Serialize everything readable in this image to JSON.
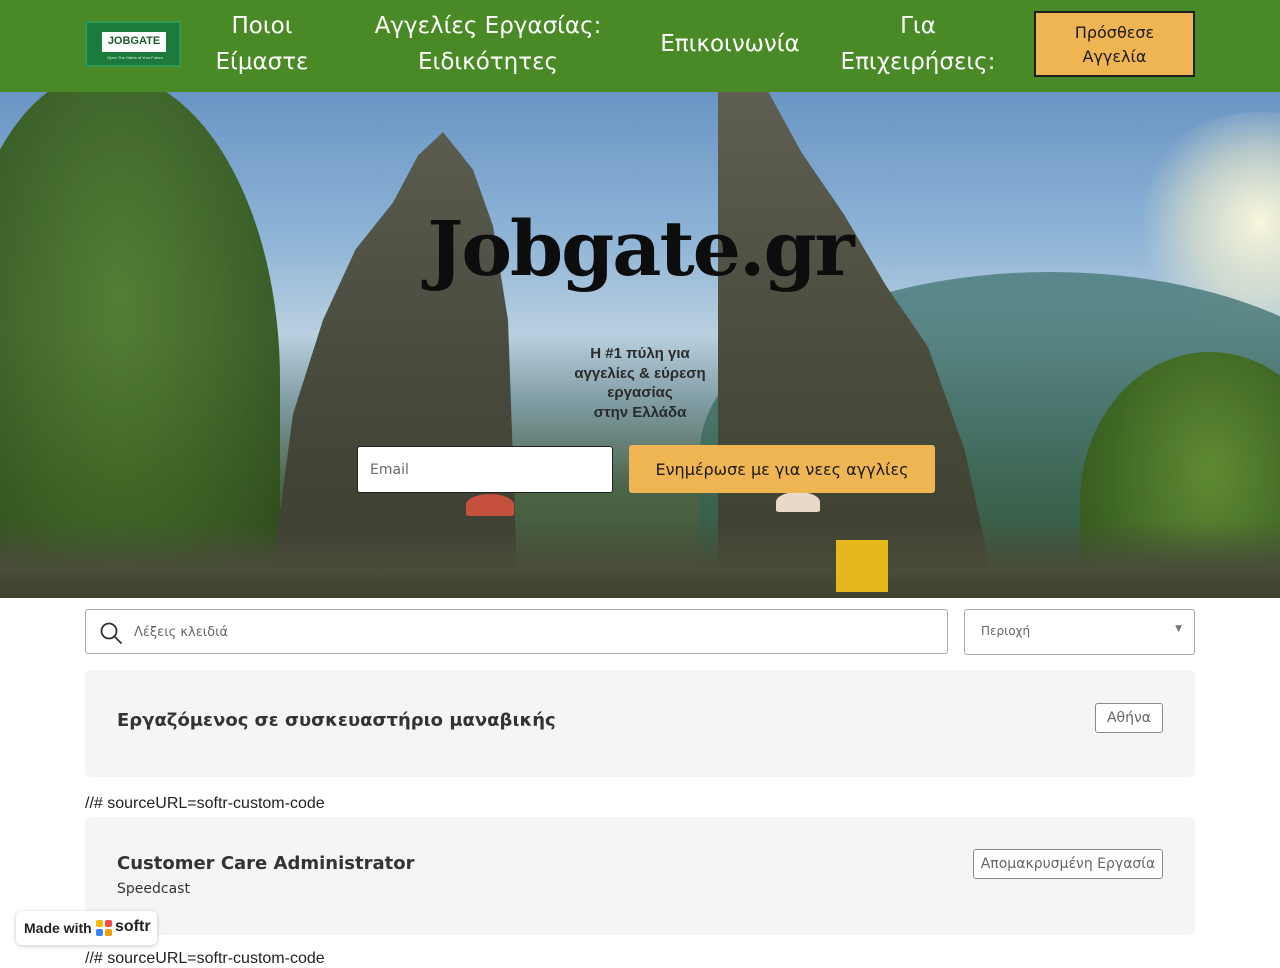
{
  "navbar": {
    "logo_text": "JOBGATE",
    "logo_tagline": "Open The Gates of Your Future",
    "links": [
      {
        "line1": "Ποιοι",
        "line2": "Είμαστε"
      },
      {
        "line1": "Αγγελίες Εργασίας:",
        "line2": "Ειδικότητες"
      },
      {
        "line1": "Επικοινωνία",
        "line2": ""
      },
      {
        "line1": "Για",
        "line2": "Επιχειρήσεις:"
      }
    ],
    "post_button": {
      "line1": "Πρόσθεσε",
      "line2": "Αγγελία"
    }
  },
  "hero": {
    "title": "Jobgate.gr",
    "subtitle": [
      "Η #1 πύλη για",
      "αγγελίες & εύρεση",
      "εργασίας",
      "στην Ελλάδα"
    ],
    "email_placeholder": "Email",
    "subscribe_label": "Ενημέρωσε με για νεες αγγλίες"
  },
  "search": {
    "placeholder": "Λέξεις κλειδιά",
    "region_label": "Περιοχή"
  },
  "jobs": [
    {
      "title": "Εργαζόμενος σε συσκευαστήριο μαναβικής",
      "company": "",
      "badge": "Αθήνα"
    },
    {
      "title": "Customer Care Administrator",
      "company": "Speedcast",
      "badge": "Απομακρυσμένη Εργασία"
    }
  ],
  "code_snippet": "//# sourceURL=softr-custom-code",
  "softr_badge": {
    "text": "Made with",
    "brand": "softr"
  },
  "colors": {
    "nav_bg": "#4a8a26",
    "accent": "#f0b553",
    "card_bg": "#f5f5f5"
  }
}
